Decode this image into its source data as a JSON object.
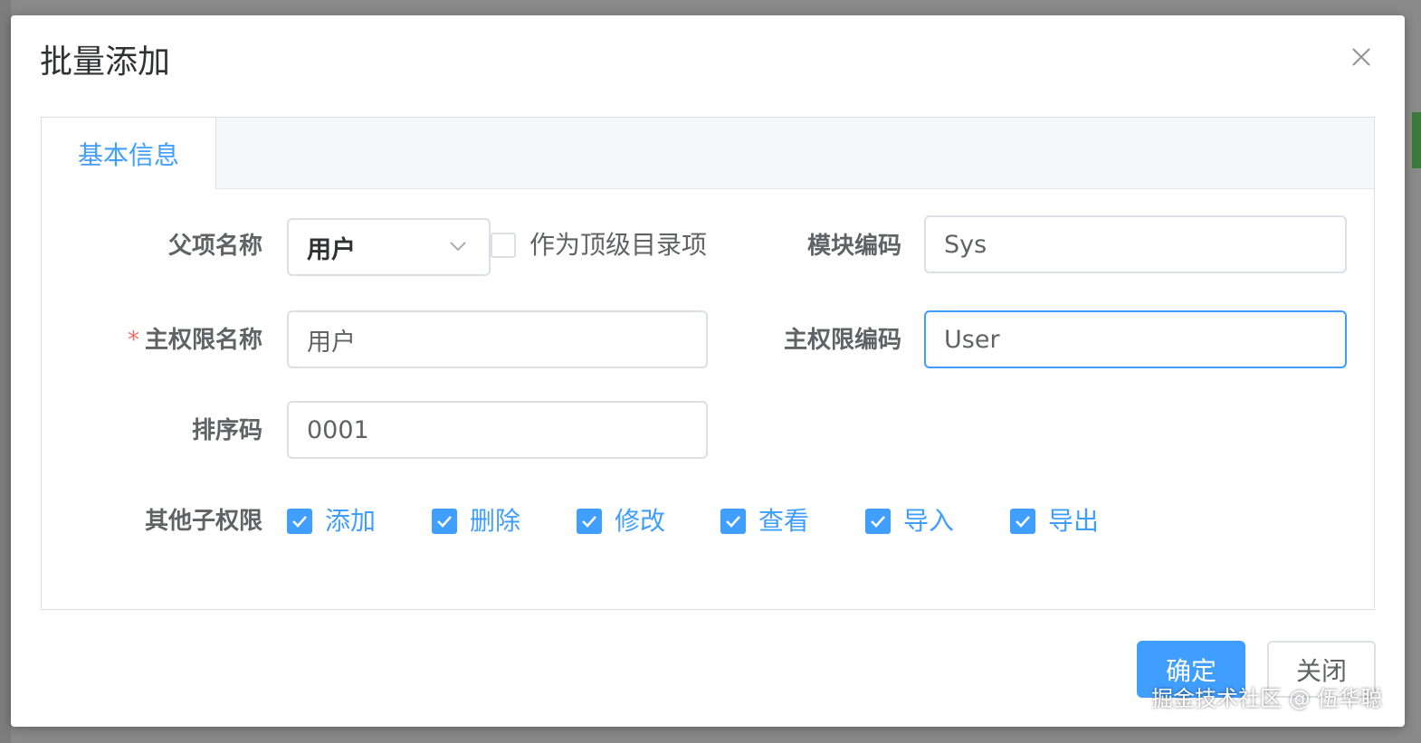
{
  "dialog": {
    "title": "批量添加",
    "close_icon": "close-icon"
  },
  "tabs": [
    {
      "label": "基本信息",
      "active": true
    }
  ],
  "form": {
    "parent_name": {
      "label": "父项名称",
      "value": "用户"
    },
    "top_level": {
      "label": "作为顶级目录项",
      "checked": false
    },
    "module_code": {
      "label": "模块编码",
      "value": "Sys"
    },
    "main_permission_name": {
      "required_mark": "*",
      "label": "主权限名称",
      "value": "用户"
    },
    "main_permission_code": {
      "label": "主权限编码",
      "value": "User"
    },
    "sort_code": {
      "label": "排序码",
      "value": "0001"
    },
    "sub_permissions": {
      "label": "其他子权限",
      "items": [
        {
          "label": "添加",
          "checked": true
        },
        {
          "label": "删除",
          "checked": true
        },
        {
          "label": "修改",
          "checked": true
        },
        {
          "label": "查看",
          "checked": true
        },
        {
          "label": "导入",
          "checked": true
        },
        {
          "label": "导出",
          "checked": true
        }
      ]
    }
  },
  "footer": {
    "confirm_label": "确定",
    "close_label": "关闭"
  },
  "watermark": "掘金技术社区 @ 伍华聪",
  "colors": {
    "accent": "#409eff",
    "required": "#f56c6c"
  }
}
